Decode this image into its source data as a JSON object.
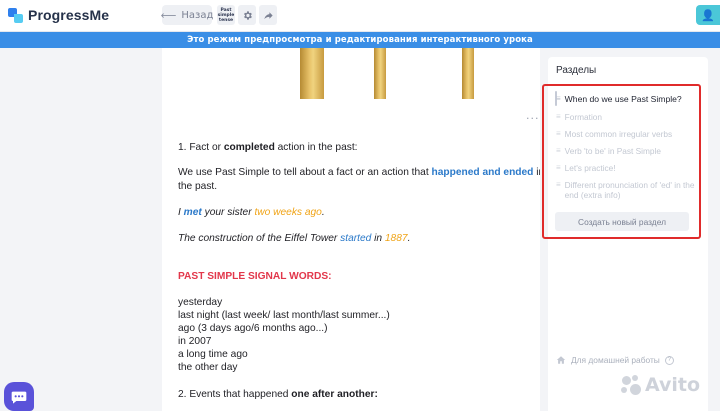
{
  "header": {
    "logo_text": "ProgressMe",
    "back_label": "Назад",
    "lesson_thumb_lines": [
      "Past",
      "simple",
      "tense"
    ],
    "settings_icon": "gear-icon",
    "share_icon": "share-arrow-icon"
  },
  "banner": {
    "text": "Это режим предпросмотра и редактирования интерактивного урока"
  },
  "content": {
    "heading1": {
      "prefix": "1. Fact or ",
      "bold": "completed",
      "suffix": " action in the past:"
    },
    "para1": {
      "line1_prefix": "We use Past Simple to tell about a fact or an action that ",
      "line1_highlight": "happened and ended",
      "line1_suffix": " in",
      "line2": "the past."
    },
    "example1": {
      "w1": "I ",
      "w2": "met",
      "w3": " your sister ",
      "w4": "two weeks ago",
      "w5": "."
    },
    "example2": {
      "w1": "The construction of the Eiffel Tower ",
      "w2": "started",
      "w3": " in ",
      "w4": "1887",
      "w5": "."
    },
    "signal_heading": "PAST SIMPLE SIGNAL WORDS:",
    "signal_words": [
      "yesterday",
      "last night (last week/ last month/last summer...)",
      "ago (3 days ago/6 months ago...)",
      "in 2007",
      "a long time ago",
      "the other day"
    ],
    "heading2": {
      "prefix": "2. Events that happened ",
      "bold": "one after another:"
    }
  },
  "panel": {
    "title": "Разделы",
    "sections": [
      {
        "label": "When do we use Past Simple?",
        "active": true
      },
      {
        "label": "Formation",
        "active": false
      },
      {
        "label": "Most common irregular verbs",
        "active": false
      },
      {
        "label": "Verb 'to be' in Past Simple",
        "active": false
      },
      {
        "label": "Let's practice!",
        "active": false
      },
      {
        "label": "Different pronunciation of 'ed' in the end (extra info)",
        "active": false
      }
    ],
    "create_button": "Создать новый раздел",
    "homework_label": "Для домашней работы",
    "homework_help": "?"
  },
  "watermark": {
    "text": "Avito"
  },
  "colors": {
    "banner": "#3a8ee6",
    "highlight_blue": "#2b79c9",
    "highlight_orange": "#f0a417",
    "signal_red": "#e2374b",
    "selection_border": "#e02b2b"
  }
}
